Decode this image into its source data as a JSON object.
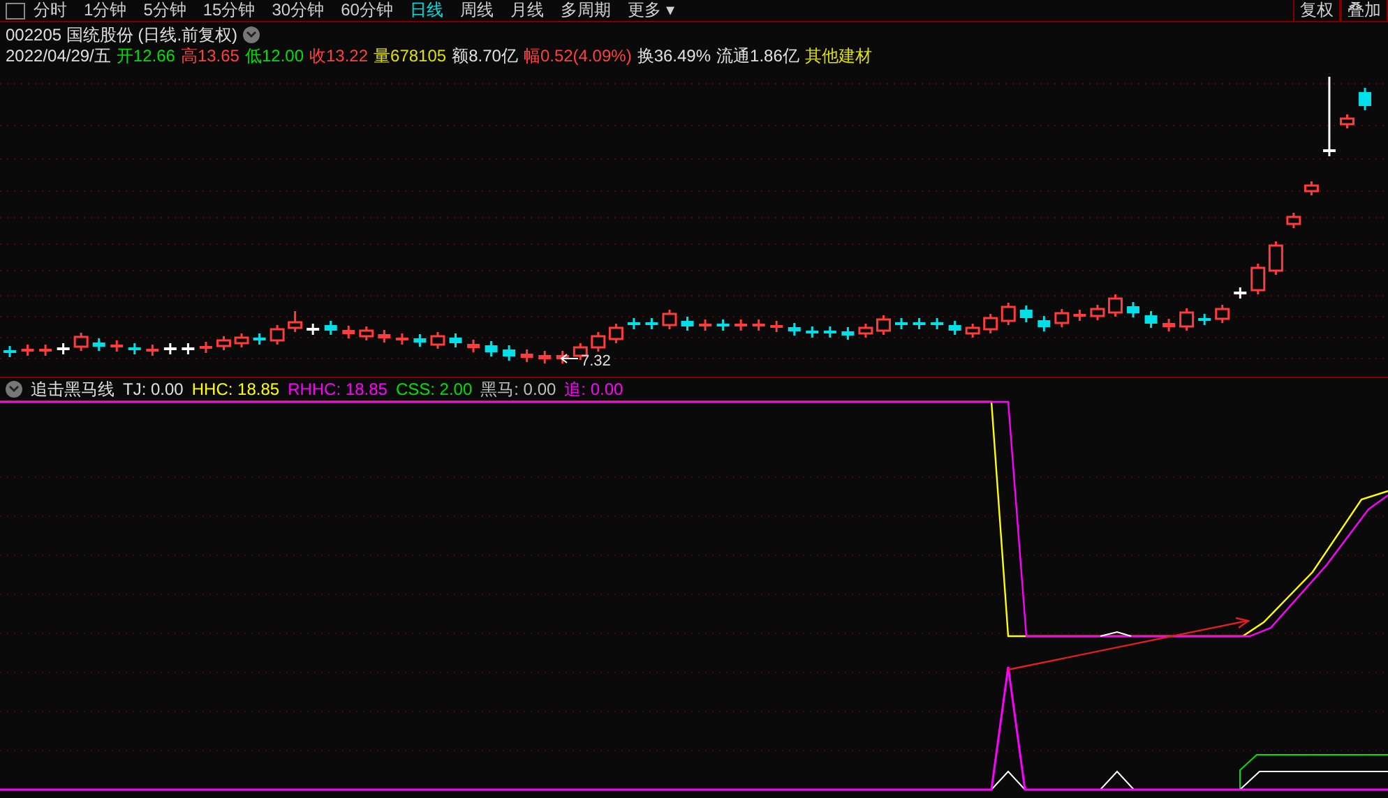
{
  "period_tabs": [
    {
      "label": "分时",
      "selected": false
    },
    {
      "label": "1分钟",
      "selected": false
    },
    {
      "label": "5分钟",
      "selected": false
    },
    {
      "label": "15分钟",
      "selected": false
    },
    {
      "label": "30分钟",
      "selected": false
    },
    {
      "label": "60分钟",
      "selected": false
    },
    {
      "label": "日线",
      "selected": true
    },
    {
      "label": "周线",
      "selected": false
    },
    {
      "label": "月线",
      "selected": false
    },
    {
      "label": "多周期",
      "selected": false
    },
    {
      "label": "更多 ▾",
      "selected": false
    }
  ],
  "toolbar_buttons": [
    "复权",
    "叠加"
  ],
  "stock_title": "002205 国统股份 (日线.前复权)",
  "quote_fields": [
    {
      "value": "2022/04/29/五",
      "color": "#e0e0e0"
    },
    {
      "label": "开",
      "value": "12.66",
      "color": "#00e000"
    },
    {
      "label": "高",
      "value": "13.65",
      "color": "#ff4040"
    },
    {
      "label": "低",
      "value": "12.00",
      "color": "#00e000"
    },
    {
      "label": "收",
      "value": "13.22",
      "color": "#ff4040"
    },
    {
      "label": "量",
      "value": "678105",
      "color": "#e0e000"
    },
    {
      "label": "额",
      "value": "8.70亿",
      "color": "#e0e0e0"
    },
    {
      "label": "幅",
      "value": "0.52(4.09%)",
      "color": "#ff4040"
    },
    {
      "label": "换",
      "value": "36.49%",
      "color": "#e0e0e0"
    },
    {
      "label": "流通",
      "value": "1.86亿",
      "color": "#e0e0e0"
    },
    {
      "value": "其他建材",
      "color": "#e0e000"
    }
  ],
  "low_marker": "7.32",
  "indicator": {
    "name": "追击黑马线",
    "values": [
      {
        "label": "TJ: ",
        "value": "0.00",
        "color": "#e0e0e0"
      },
      {
        "label": "HHC: ",
        "value": "18.85",
        "color": "#ffff00"
      },
      {
        "label": "RHHC: ",
        "value": "18.85",
        "color": "#ff00ff"
      },
      {
        "label": "CSS: ",
        "value": "2.00",
        "color": "#00e000"
      },
      {
        "label": "黑马: ",
        "value": "0.00",
        "color": "#c0c0c0"
      },
      {
        "label": "追: ",
        "value": "0.00",
        "color": "#ff00ff"
      }
    ]
  }
}
